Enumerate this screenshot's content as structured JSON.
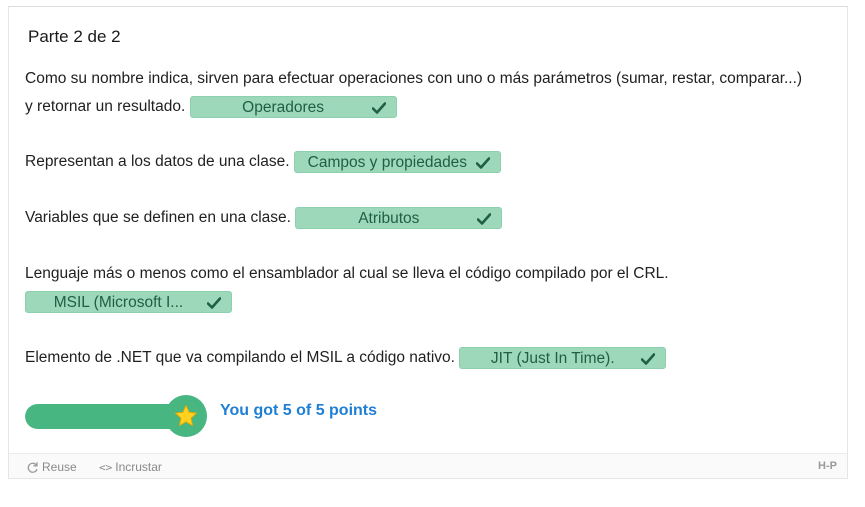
{
  "part_title": "Parte 2 de 2",
  "questions": [
    {
      "text_a": "Como su nombre indica, sirven para efectuar operaciones con uno o más parámetros (sumar, restar, comparar...)",
      "text_b": "y retornar un resultado.",
      "answer": "Operadores"
    },
    {
      "text": "Representan a los datos de una clase.",
      "answer": "Campos y propiedades"
    },
    {
      "text": "Variables que se definen en una clase.",
      "answer": "Atributos"
    },
    {
      "text": "Lenguaje más o menos como el ensamblador al cual se lleva el código compilado por el CRL.",
      "answer": "MSIL (Microsoft I..."
    },
    {
      "text": "Elemento de .NET que va compilando el MSIL a código nativo.",
      "answer": "JIT (Just In Time)."
    }
  ],
  "score": {
    "text": "You got 5 of 5 points",
    "fraction": 1.0
  },
  "footer": {
    "reuse": "Reuse",
    "embed": "Incrustar",
    "logo": "H-P"
  },
  "colors": {
    "correct_bg": "#9dd8bb",
    "progress": "#47b681",
    "score_text": "#1f7fd4"
  },
  "icons": {
    "check": "check-icon",
    "star": "star-icon",
    "reuse": "reuse-icon",
    "embed": "embed-icon"
  }
}
